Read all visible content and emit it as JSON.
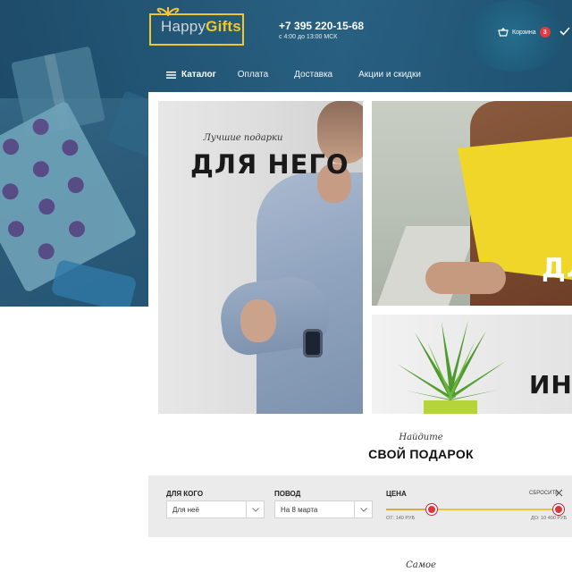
{
  "brand": {
    "happy": "Happy",
    "gifts": "Gifts"
  },
  "contact": {
    "phone": "+7 395 220-15-68",
    "hours": "с 4:00 до 13:00 МСК"
  },
  "cart": {
    "label": "Корзина",
    "count": "3"
  },
  "nav": {
    "catalog": "Каталог",
    "links": [
      "Оплата",
      "Доставка",
      "Акции и скидки"
    ]
  },
  "promo": {
    "him_subtitle": "Лучшие подарки",
    "him_title": "ДЛЯ НЕГО",
    "her_title": "ДЛ",
    "home_title": "ИН"
  },
  "finder": {
    "subtitle": "Найдите",
    "title": "СВОЙ ПОДАРОК"
  },
  "filter": {
    "for_whom_label": "ДЛЯ КОГО",
    "for_whom_value": "Для неё",
    "occasion_label": "ПОВОД",
    "occasion_value": "На 8 марта",
    "price_label": "ЦЕНА",
    "reset_label": "СБРОСИТЬ",
    "price_min_text": "ОТ: 140 РУБ",
    "price_max_text": "ДО: 10 400 РУБ"
  },
  "bottom": {
    "subtitle": "Самое"
  },
  "colors": {
    "accent_yellow": "#f1c72b",
    "badge_red": "#e23b3b",
    "range_knob": "#d9363e",
    "hero_blue": "#2c5c7a"
  }
}
